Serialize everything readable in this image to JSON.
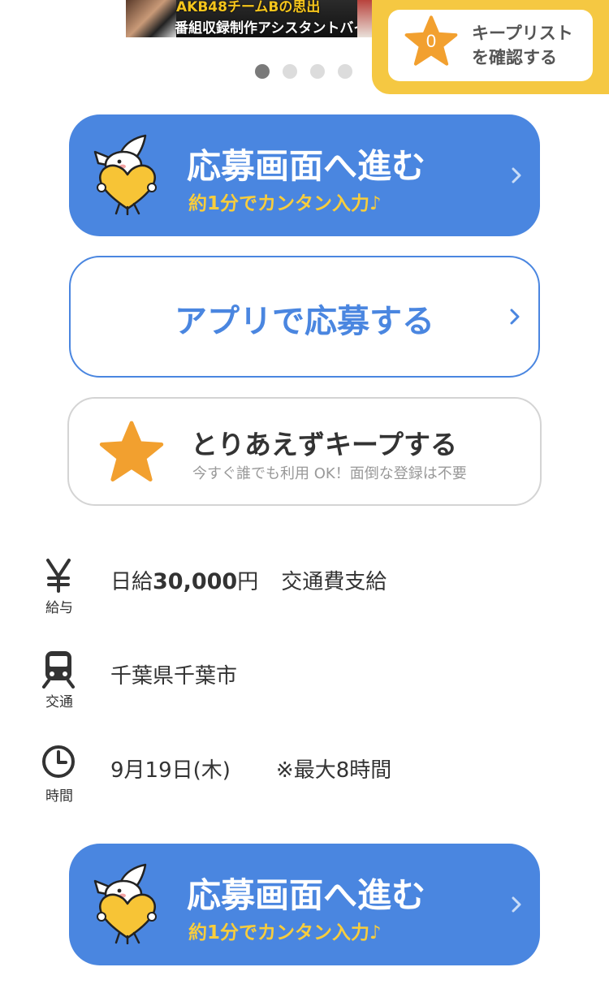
{
  "banner": {
    "line1": "AKB48チームBの思出",
    "line2": "番組収録制作アシスタントバイト"
  },
  "carousel": {
    "dots": 4,
    "active_index": 0
  },
  "keep_list": {
    "count": "0",
    "label_line1": "キープリスト",
    "label_line2": "を確認する"
  },
  "apply_button_top": {
    "label": "応募画面へ進む",
    "sub_label": "約1分でカンタン入力♪"
  },
  "app_apply_button": {
    "label": "アプリで応募する"
  },
  "keep_button": {
    "label": "とりあえずキープする",
    "sub_label": "今すぐ誰でも利用 OK！面倒な登録は不要"
  },
  "info": {
    "salary": {
      "caption": "給与",
      "prefix": "日給",
      "amount": "30,000",
      "unit": "円",
      "extra": "交通費支給"
    },
    "transport": {
      "caption": "交通",
      "value": "千葉県千葉市"
    },
    "time": {
      "caption": "時間",
      "date": "9月19日(木)",
      "note": "※最大8時間"
    }
  },
  "apply_button_bottom": {
    "label": "応募画面へ進む",
    "sub_label": "約1分でカンタン入力♪"
  },
  "colors": {
    "primary": "#4a86e0",
    "accent_yellow": "#f8cd3c",
    "keep_panel": "#f5c842",
    "star": "#f2a02f"
  },
  "icons": [
    "yen-icon",
    "train-icon",
    "clock-icon",
    "star-icon",
    "chevron-right-icon",
    "mascot-heart-icon"
  ]
}
